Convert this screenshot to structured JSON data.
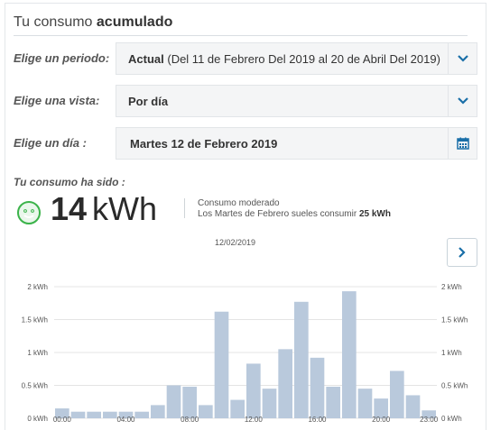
{
  "header": {
    "title_light": "Tu consumo",
    "title_bold": "acumulado"
  },
  "period": {
    "label": "Elige un periodo:",
    "value_bold": "Actual",
    "value_rest": "(Del 11 de Febrero Del 2019 al 20 de Abril Del 2019)",
    "icon": "chevron-down-icon"
  },
  "view": {
    "label": "Elige una vista:",
    "value": "Por día",
    "icon": "chevron-down-icon"
  },
  "day": {
    "label": "Elige un día :",
    "value": "Martes 12 de Febrero 2019",
    "icon": "calendar-icon"
  },
  "consumption": {
    "heading": "Tu consumo ha sido :",
    "value": "14",
    "unit": "kWh",
    "status": "Consumo moderado",
    "comparison_text": "Los Martes de Febrero sueles consumir",
    "comparison_value": "25 kWh",
    "icon": "smiley-icon"
  },
  "chart_nav": {
    "date": "12/02/2019",
    "next_icon": "chevron-right-icon"
  },
  "colors": {
    "accent": "#1a6fa8",
    "bar": "#b9c9dc",
    "smiley": "#3bb34a",
    "grid": "#e4e4e4"
  },
  "chart_data": {
    "type": "bar",
    "categories": [
      "00:00",
      "01:00",
      "02:00",
      "03:00",
      "04:00",
      "05:00",
      "06:00",
      "07:00",
      "08:00",
      "09:00",
      "10:00",
      "11:00",
      "12:00",
      "13:00",
      "14:00",
      "15:00",
      "16:00",
      "17:00",
      "18:00",
      "19:00",
      "20:00",
      "21:00",
      "22:00",
      "23:00"
    ],
    "series": [
      {
        "values": [
          0.15,
          0.1,
          0.1,
          0.1,
          0.1,
          0.1,
          0.2,
          0.5,
          0.48,
          0.2,
          1.62,
          0.28,
          0.83,
          0.45,
          1.05,
          1.77,
          0.92,
          0.48,
          1.93,
          0.45,
          0.3,
          0.72,
          0.35,
          0.12
        ]
      }
    ],
    "x_tick_labels": [
      "00:00",
      "04:00",
      "08:00",
      "12:00",
      "16:00",
      "20:00",
      "23:00"
    ],
    "y_ticks": [
      0,
      0.5,
      1,
      1.5,
      2
    ],
    "y_tick_labels": [
      "0 kWh",
      "0.5 kWh",
      "1 kWh",
      "1.5 kWh",
      "2 kWh"
    ],
    "ylim": [
      0,
      2
    ],
    "grid": true,
    "legend": "none"
  }
}
